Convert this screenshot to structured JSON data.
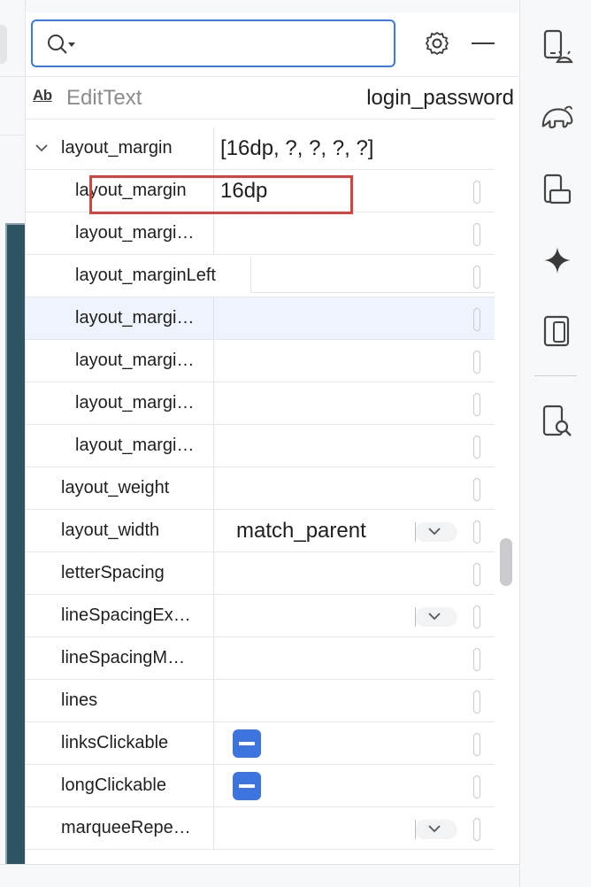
{
  "search": {
    "value": "",
    "placeholder": ""
  },
  "component": {
    "type_icon": "Ab",
    "type": "EditText",
    "id": "login_password"
  },
  "attributes": [
    {
      "name": "layout_margin",
      "value": "[16dp, ?, ?, ?, ?]",
      "expanded": true,
      "child": false
    },
    {
      "name": "layout_margin",
      "value": "16dp",
      "child": true
    },
    {
      "name": "layout_margi…",
      "value": "",
      "child": true
    },
    {
      "name": "layout_marginLeft",
      "value": "",
      "child": true
    },
    {
      "name": "layout_margi…",
      "value": "",
      "child": true,
      "selected": true
    },
    {
      "name": "layout_margi…",
      "value": "",
      "child": true
    },
    {
      "name": "layout_margi…",
      "value": "",
      "child": true
    },
    {
      "name": "layout_margi…",
      "value": "",
      "child": true
    },
    {
      "name": "layout_weight",
      "value": "",
      "child": false
    },
    {
      "name": "layout_width",
      "value": "match_parent",
      "dropdown": true,
      "child": false
    },
    {
      "name": "letterSpacing",
      "value": "",
      "child": false
    },
    {
      "name": "lineSpacingEx…",
      "value": "",
      "dropdown": true,
      "child": false
    },
    {
      "name": "lineSpacingM…",
      "value": "",
      "child": false
    },
    {
      "name": "lines",
      "value": "",
      "child": false
    },
    {
      "name": "linksClickable",
      "value": "",
      "toggle": true,
      "child": false
    },
    {
      "name": "longClickable",
      "value": "",
      "toggle": true,
      "child": false
    },
    {
      "name": "marqueeRepe…",
      "value": "",
      "dropdown": true,
      "child": false
    }
  ],
  "icons": {
    "search": "search-icon",
    "settings": "gear-icon",
    "minimize": "minimize-icon",
    "tools": [
      "device-manager-icon",
      "gradle-elephant-icon",
      "running-devices-icon",
      "gemini-sparkle-icon",
      "device-mirroring-icon",
      "app-inspection-icon"
    ]
  },
  "colors": {
    "accent": "#3a7ae6",
    "highlight": "#d5433a",
    "toggle": "#3d74e0"
  }
}
